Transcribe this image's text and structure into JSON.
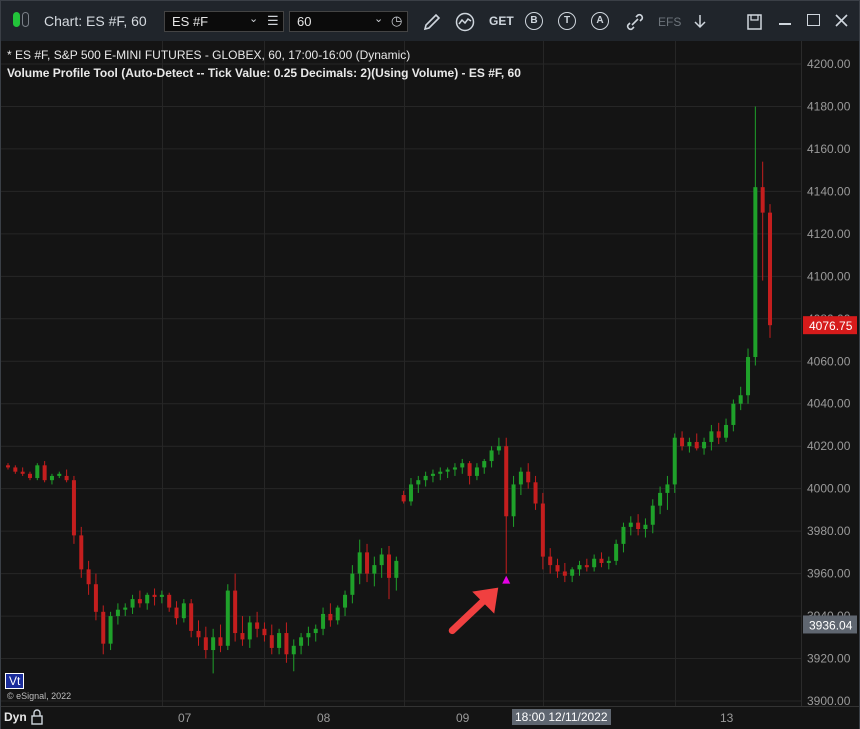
{
  "window": {
    "title": "Chart: ES #F, 60",
    "symbol_value": "ES #F",
    "interval_value": "60"
  },
  "toolbar": {
    "get_label": "GET",
    "b_label": "B",
    "t_label": "T",
    "a_label": "A",
    "efs_label": "EFS"
  },
  "chart": {
    "info_line1": "* ES #F, S&P 500 E-MINI FUTURES - GLOBEX, 60, 17:00-16:00 (Dynamic)",
    "info_line2": "Volume Profile Tool (Auto-Detect -- Tick Value: 0.25 Decimals: 2)(Using Volume) - ES #F, 60",
    "copyright": "© eSignal, 2022",
    "vt_badge": "Vt",
    "last_price_label": "4076.75",
    "last_price_color": "#d61b1b",
    "cursor_price_label": "3936.04",
    "cursor_time_label": "18:00 12/11/2022",
    "dyn_label": "Dyn",
    "up_color": "#1fa12a",
    "down_color": "#c41e1e",
    "marker_color": "#e600e6",
    "arrow_color": "#f04040"
  },
  "chart_data": {
    "type": "candlestick",
    "title": "",
    "ylabel": "",
    "ylim": [
      3900,
      4200
    ],
    "y_ticks": [
      "3900.00",
      "3920.00",
      "3940.00",
      "3960.00",
      "3980.00",
      "4000.00",
      "4020.00",
      "4040.00",
      "4060.00",
      "4080.00",
      "4100.00",
      "4120.00",
      "4140.00",
      "4160.00",
      "4180.00",
      "4200.00"
    ],
    "x_ticks": [
      "07",
      "08",
      "09",
      "13"
    ],
    "grid": true,
    "note_markers": [
      {
        "type": "triangle-up",
        "bar": 68
      }
    ],
    "candles": [
      [
        4011,
        4012,
        4009,
        4010
      ],
      [
        4010,
        4011,
        4007,
        4008
      ],
      [
        4008,
        4010,
        4006,
        4007
      ],
      [
        4007,
        4008,
        4004,
        4005
      ],
      [
        4005,
        4012,
        4004,
        4011
      ],
      [
        4011,
        4013,
        4003,
        4004
      ],
      [
        4004,
        4007,
        4002,
        4006
      ],
      [
        4006,
        4008,
        4005,
        4007
      ],
      [
        4006,
        4009,
        4003,
        4004
      ],
      [
        4004,
        4006,
        3974,
        3978
      ],
      [
        3978,
        3982,
        3958,
        3962
      ],
      [
        3962,
        3966,
        3950,
        3955
      ],
      [
        3955,
        3960,
        3938,
        3942
      ],
      [
        3942,
        3945,
        3922,
        3927
      ],
      [
        3927,
        3942,
        3924,
        3940
      ],
      [
        3940,
        3946,
        3936,
        3943
      ],
      [
        3943,
        3946,
        3940,
        3944
      ],
      [
        3944,
        3950,
        3941,
        3948
      ],
      [
        3948,
        3952,
        3944,
        3946
      ],
      [
        3946,
        3951,
        3943,
        3950
      ],
      [
        3950,
        3953,
        3945,
        3949
      ],
      [
        3949,
        3952,
        3946,
        3950
      ],
      [
        3950,
        3951,
        3942,
        3944
      ],
      [
        3944,
        3947,
        3936,
        3939
      ],
      [
        3939,
        3948,
        3937,
        3946
      ],
      [
        3946,
        3948,
        3930,
        3933
      ],
      [
        3933,
        3938,
        3926,
        3930
      ],
      [
        3930,
        3935,
        3920,
        3924
      ],
      [
        3924,
        3934,
        3913,
        3930
      ],
      [
        3930,
        3936,
        3923,
        3926
      ],
      [
        3926,
        3955,
        3924,
        3952
      ],
      [
        3952,
        3960,
        3928,
        3932
      ],
      [
        3932,
        3940,
        3926,
        3929
      ],
      [
        3929,
        3940,
        3925,
        3937
      ],
      [
        3937,
        3942,
        3930,
        3934
      ],
      [
        3934,
        3937,
        3928,
        3931
      ],
      [
        3931,
        3936,
        3922,
        3925
      ],
      [
        3925,
        3934,
        3922,
        3932
      ],
      [
        3932,
        3937,
        3918,
        3922
      ],
      [
        3922,
        3929,
        3914,
        3926
      ],
      [
        3926,
        3932,
        3922,
        3930
      ],
      [
        3930,
        3935,
        3926,
        3932
      ],
      [
        3932,
        3936,
        3928,
        3934
      ],
      [
        3934,
        3944,
        3931,
        3941
      ],
      [
        3941,
        3946,
        3935,
        3938
      ],
      [
        3938,
        3945,
        3936,
        3944
      ],
      [
        3944,
        3952,
        3940,
        3950
      ],
      [
        3950,
        3964,
        3946,
        3960
      ],
      [
        3960,
        3976,
        3955,
        3970
      ],
      [
        3970,
        3974,
        3956,
        3960
      ],
      [
        3960,
        3968,
        3954,
        3964
      ],
      [
        3964,
        3972,
        3958,
        3969
      ],
      [
        3969,
        3973,
        3948,
        3958
      ],
      [
        3958,
        3968,
        3952,
        3966
      ],
      [
        3997,
        3999,
        3993,
        3994
      ],
      [
        3994,
        4005,
        3992,
        4002
      ],
      [
        4002,
        4006,
        3998,
        4004
      ],
      [
        4004,
        4008,
        4001,
        4006
      ],
      [
        4006,
        4009,
        4003,
        4007
      ],
      [
        4007,
        4010,
        4004,
        4008
      ],
      [
        4008,
        4010,
        4005,
        4009
      ],
      [
        4009,
        4012,
        4006,
        4010
      ],
      [
        4010,
        4014,
        4007,
        4012
      ],
      [
        4012,
        4013,
        4002,
        4006
      ],
      [
        4006,
        4012,
        4004,
        4010
      ],
      [
        4010,
        4014,
        4007,
        4013
      ],
      [
        4013,
        4020,
        4010,
        4018
      ],
      [
        4018,
        4024,
        4016,
        4020
      ],
      [
        4020,
        4024,
        3960,
        3987
      ],
      [
        3987,
        4006,
        3982,
        4002
      ],
      [
        4002,
        4010,
        3997,
        4008
      ],
      [
        4008,
        4012,
        4000,
        4003
      ],
      [
        4003,
        4006,
        3990,
        3993
      ],
      [
        3993,
        3998,
        3962,
        3968
      ],
      [
        3968,
        3972,
        3960,
        3964
      ],
      [
        3964,
        3967,
        3958,
        3961
      ],
      [
        3961,
        3965,
        3956,
        3959
      ],
      [
        3959,
        3963,
        3956,
        3962
      ],
      [
        3962,
        3966,
        3959,
        3964
      ],
      [
        3964,
        3967,
        3961,
        3963
      ],
      [
        3963,
        3969,
        3961,
        3967
      ],
      [
        3967,
        3970,
        3963,
        3965
      ],
      [
        3965,
        3968,
        3962,
        3966
      ],
      [
        3966,
        3976,
        3964,
        3974
      ],
      [
        3974,
        3984,
        3970,
        3982
      ],
      [
        3982,
        3987,
        3978,
        3984
      ],
      [
        3984,
        3988,
        3978,
        3981
      ],
      [
        3981,
        3986,
        3977,
        3983
      ],
      [
        3983,
        3995,
        3979,
        3992
      ],
      [
        3992,
        4001,
        3988,
        3998
      ],
      [
        3998,
        4006,
        3990,
        4002
      ],
      [
        4002,
        4026,
        3998,
        4024
      ],
      [
        4024,
        4027,
        4018,
        4020
      ],
      [
        4020,
        4024,
        4017,
        4022
      ],
      [
        4022,
        4026,
        4018,
        4019
      ],
      [
        4019,
        4024,
        4016,
        4022
      ],
      [
        4022,
        4030,
        4018,
        4027
      ],
      [
        4027,
        4031,
        4021,
        4024
      ],
      [
        4024,
        4033,
        4022,
        4030
      ],
      [
        4030,
        4042,
        4027,
        4040
      ],
      [
        4040,
        4048,
        4037,
        4044
      ],
      [
        4044,
        4066,
        4040,
        4062
      ],
      [
        4062,
        4180,
        4058,
        4142
      ],
      [
        4142,
        4154,
        4098,
        4130
      ],
      [
        4130,
        4134,
        4071,
        4077
      ]
    ]
  }
}
